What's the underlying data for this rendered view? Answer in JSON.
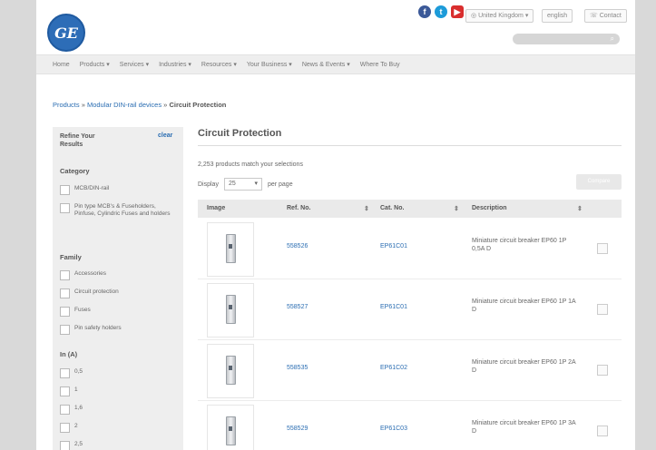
{
  "header": {
    "logo_text": "GE",
    "social": [
      {
        "icon": "facebook-icon",
        "glyph": "f"
      },
      {
        "icon": "twitter-icon",
        "glyph": "t"
      },
      {
        "icon": "youtube-icon",
        "glyph": "▶"
      }
    ],
    "country": "United Kingdom",
    "language": "english",
    "contact": "Contact",
    "search_icon": "search-icon"
  },
  "nav": [
    "Home",
    "Products",
    "Services",
    "Industries",
    "Resources",
    "Your Business",
    "News & Events",
    "Where To Buy"
  ],
  "breadcrumb": {
    "products": "Products",
    "separator": "»",
    "modular": "Modular DIN-rail devices",
    "current": "Circuit Protection"
  },
  "sidebar": {
    "heading": "Refine Your Results",
    "clear": "clear",
    "category_title": "Category",
    "category_items": [
      "MCB/DIN-rail",
      "Pin type MCB's & Fuseholders, Pinfuse, Cylindric Fuses and holders"
    ],
    "family_title": "Family",
    "family_items": [
      "Accessories",
      "Circuit protection",
      "Fuses",
      "Pin safety holders"
    ],
    "in_title": "In (A)",
    "in_items": [
      "0,5",
      "1",
      "1,6",
      "2",
      "2,5"
    ]
  },
  "main": {
    "title": "Circuit Protection",
    "count_text": "2,253 products match your selections",
    "display_label": "Display",
    "display_value": "25",
    "per_page": "per page",
    "compare_label": "Compare"
  },
  "table": {
    "headers": [
      "Image",
      "Ref. No.",
      "Cat. No.",
      "Description"
    ],
    "rows": [
      {
        "ref": "558526",
        "cat": "EP61C01",
        "desc": "Miniature circuit breaker EP60 1P 0,5A D"
      },
      {
        "ref": "558527",
        "cat": "EP61C01",
        "desc": "Miniature circuit breaker EP60 1P 1A D"
      },
      {
        "ref": "558535",
        "cat": "EP61C02",
        "desc": "Miniature circuit breaker EP60 1P 2A D"
      },
      {
        "ref": "558529",
        "cat": "EP61C03",
        "desc": "Miniature circuit breaker EP60 1P 3A D"
      }
    ]
  },
  "colors": {
    "link": "#2a6db2",
    "ge_blue": "#2d6db7",
    "sidebar_bg": "#eeeeee"
  }
}
